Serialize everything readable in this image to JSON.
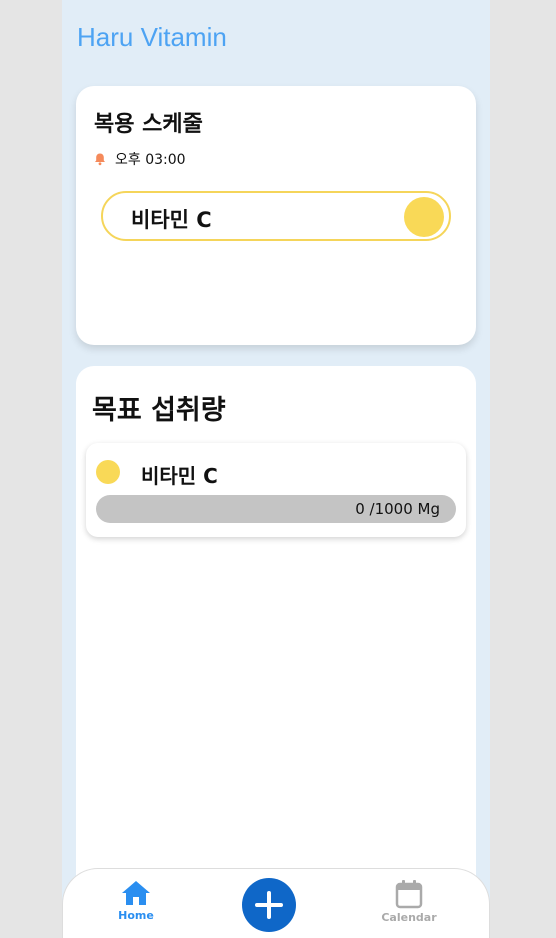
{
  "app": {
    "title": "Haru Vitamin"
  },
  "schedule": {
    "heading": "복용 스케줄",
    "alarm_time": "오후 03:00",
    "items": [
      {
        "label": "비타민 C",
        "color": "#f9d957",
        "checked": true
      }
    ]
  },
  "goal": {
    "heading": "목표 섭취량",
    "items": [
      {
        "name": "비타민 C",
        "color": "#f9d957",
        "progress_text": "0 /1000 Mg",
        "current": 0,
        "target": 1000,
        "unit": "Mg"
      }
    ]
  },
  "tabbar": {
    "home_label": "Home",
    "calendar_label": "Calendar",
    "add_icon": "plus-icon",
    "active": "home"
  },
  "colors": {
    "accent": "#2a8ef0",
    "add_button": "#0f67c8",
    "vitamin_c": "#f9d957",
    "bell": "#f58a5b"
  }
}
